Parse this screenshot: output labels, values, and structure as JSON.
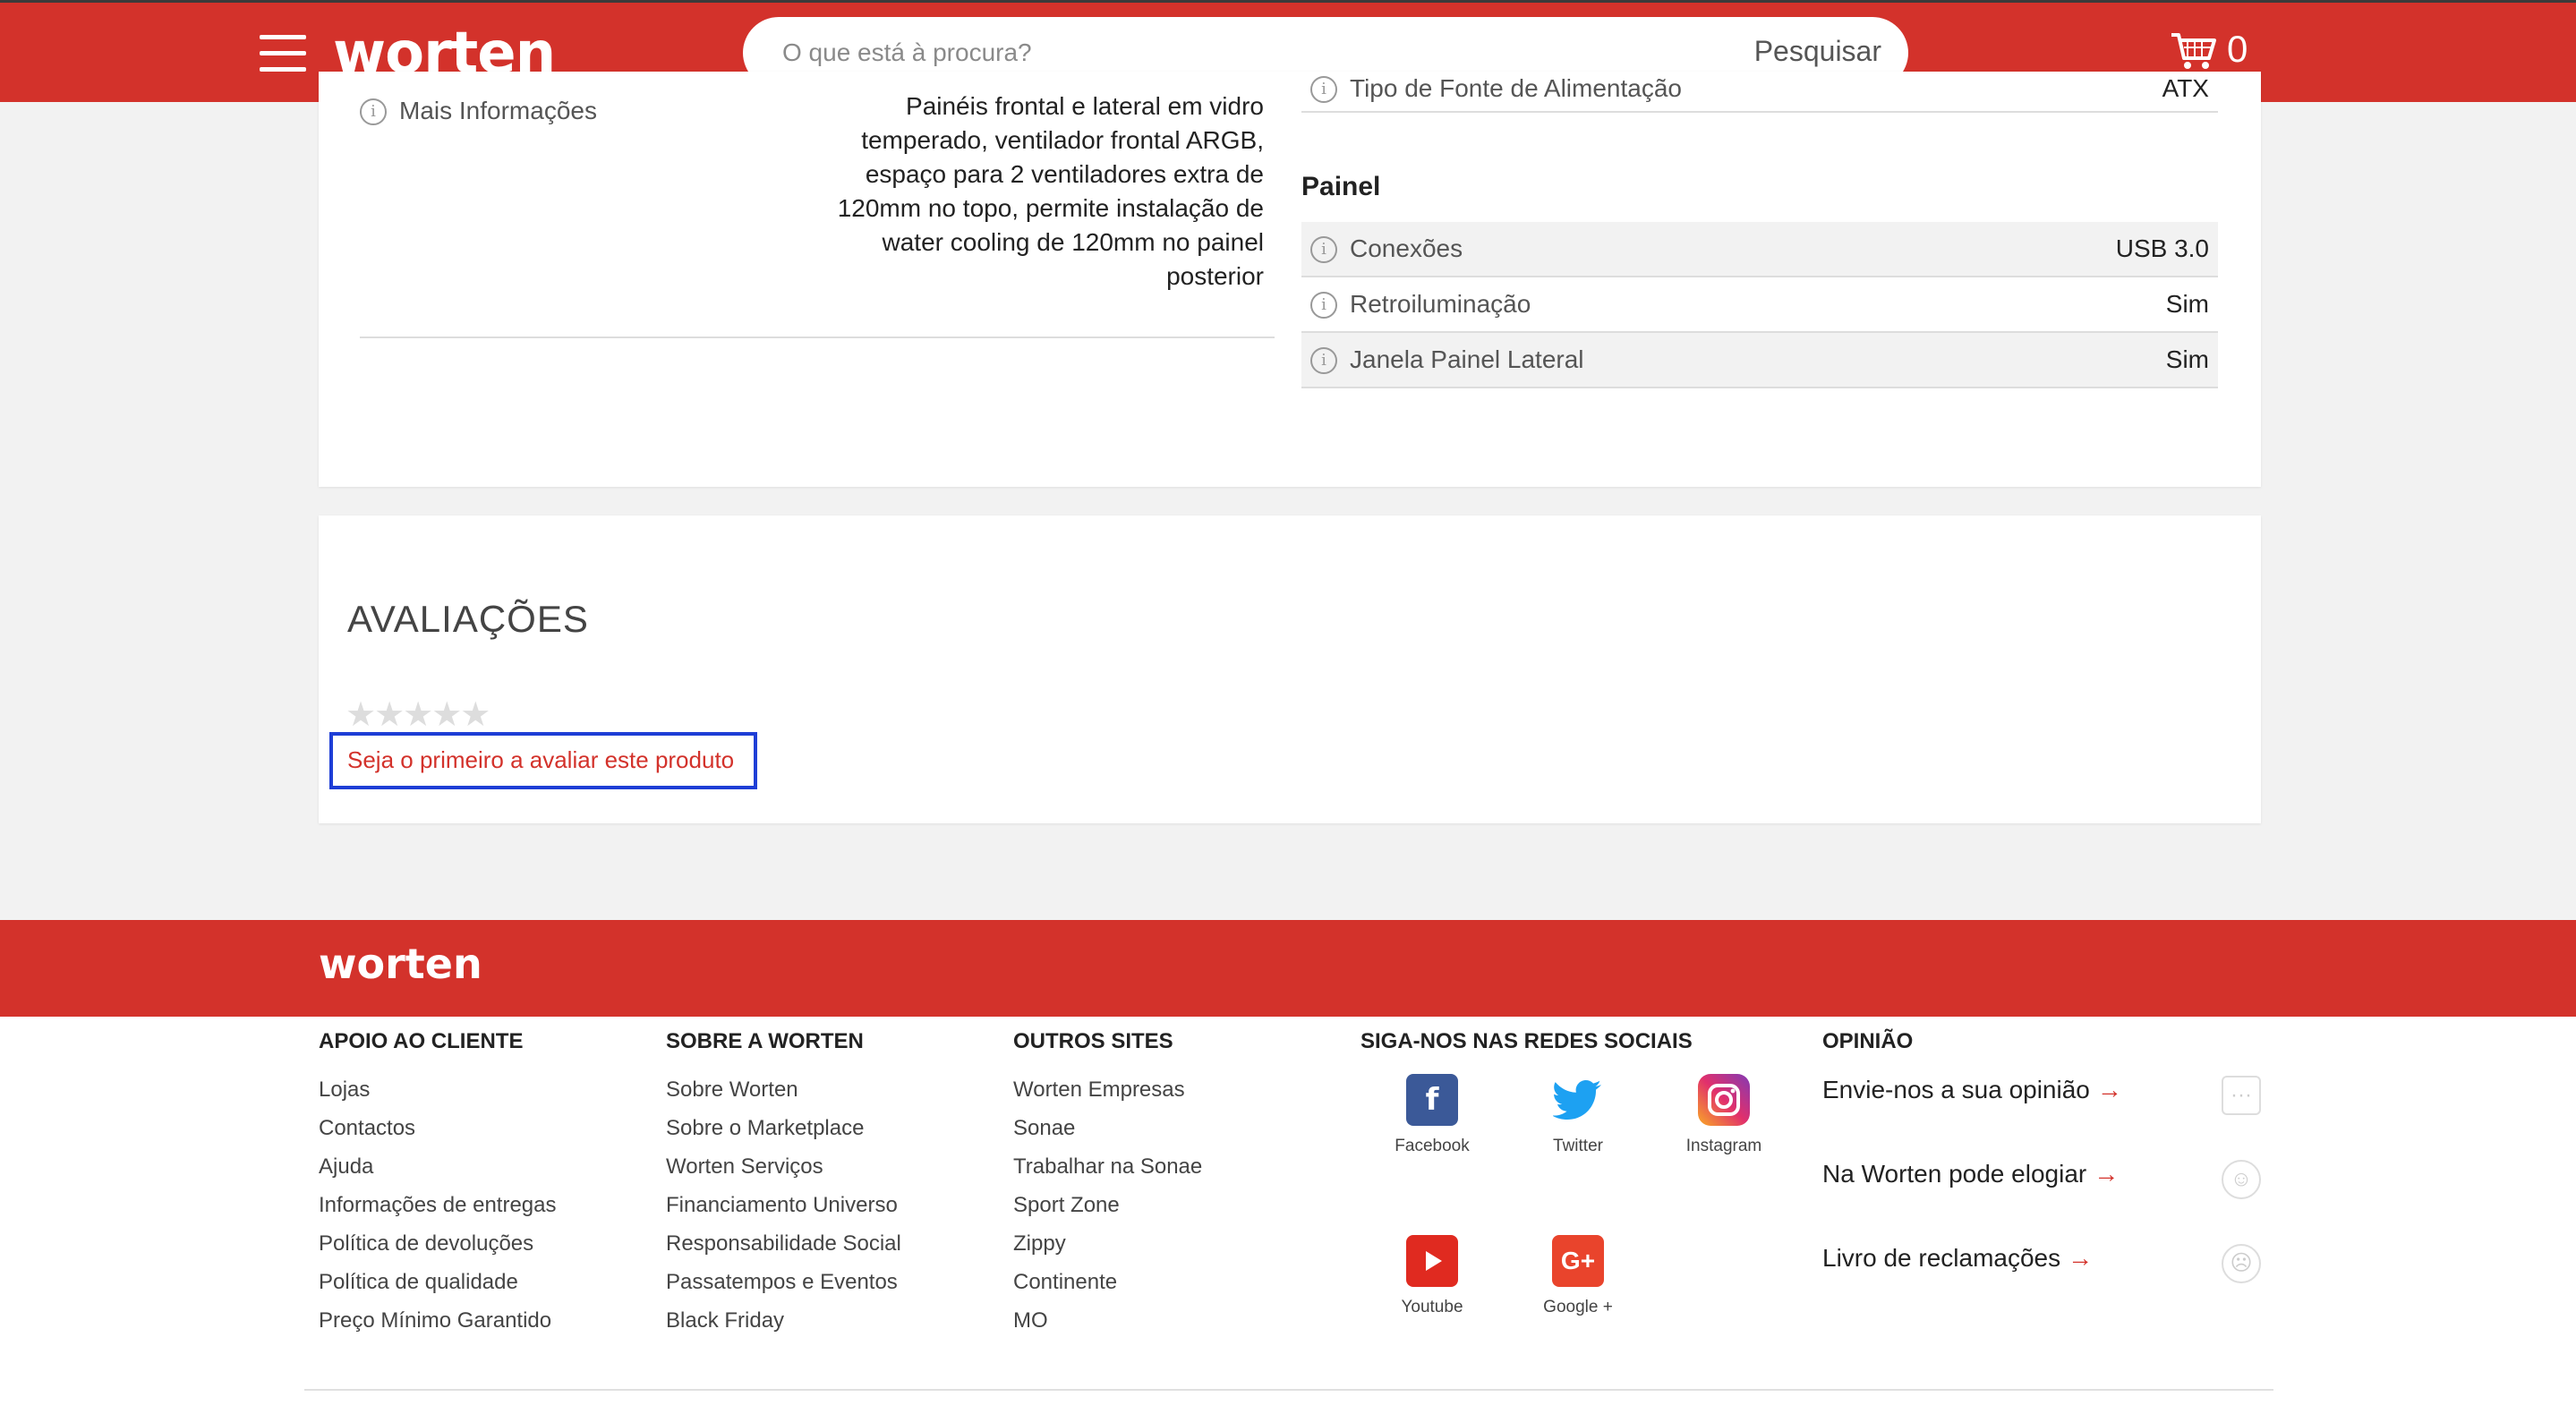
{
  "header": {
    "logo": "worten",
    "search_placeholder": "O que está à procura?",
    "search_button": "Pesquisar",
    "cart_count": "0"
  },
  "specs": {
    "left": {
      "label": "Mais Informações",
      "value": "Painéis frontal e lateral em vidro temperado, ventilador frontal ARGB, espaço para 2 ventiladores extra de 120mm no topo, permite instalação de water cooling de 120mm no painel posterior"
    },
    "power": {
      "label": "Tipo de Fonte de Alimentação",
      "value": "ATX"
    },
    "panel_title": "Painel",
    "panel_rows": [
      {
        "label": "Conexões",
        "value": "USB 3.0"
      },
      {
        "label": "Retroiluminação",
        "value": "Sim"
      },
      {
        "label": "Janela Painel Lateral",
        "value": "Sim"
      }
    ]
  },
  "reviews": {
    "title": "AVALIAÇÕES",
    "stars": "★★★★★",
    "rating": 0,
    "first_review_link": "Seja o primeiro a avaliar este produto"
  },
  "footer": {
    "logo": "worten",
    "apoio": {
      "title": "APOIO AO CLIENTE",
      "links": [
        "Lojas",
        "Contactos",
        "Ajuda",
        "Informações de entregas",
        "Política de devoluções",
        "Política de qualidade",
        "Preço Mínimo Garantido"
      ]
    },
    "sobre": {
      "title": "SOBRE A WORTEN",
      "links": [
        "Sobre Worten",
        "Sobre o Marketplace",
        "Worten Serviços",
        "Financiamento Universo",
        "Responsabilidade Social",
        "Passatempos e Eventos",
        "Black Friday"
      ]
    },
    "outros": {
      "title": "OUTROS SITES",
      "links": [
        "Worten Empresas",
        "Sonae",
        "Trabalhar na Sonae",
        "Sport Zone",
        "Zippy",
        "Continente",
        "MO"
      ]
    },
    "social": {
      "title": "SIGA-NOS NAS REDES SOCIAIS",
      "items": [
        "Facebook",
        "Twitter",
        "Instagram",
        "Youtube",
        "Google +"
      ]
    },
    "opiniao": {
      "title": "OPINIÃO",
      "items": [
        "Envie-nos a sua opinião",
        "Na Worten pode elogiar",
        "Livro de reclamações"
      ]
    }
  },
  "colors": {
    "brand": "#d3322b",
    "highlight": "#1e3ed6"
  }
}
